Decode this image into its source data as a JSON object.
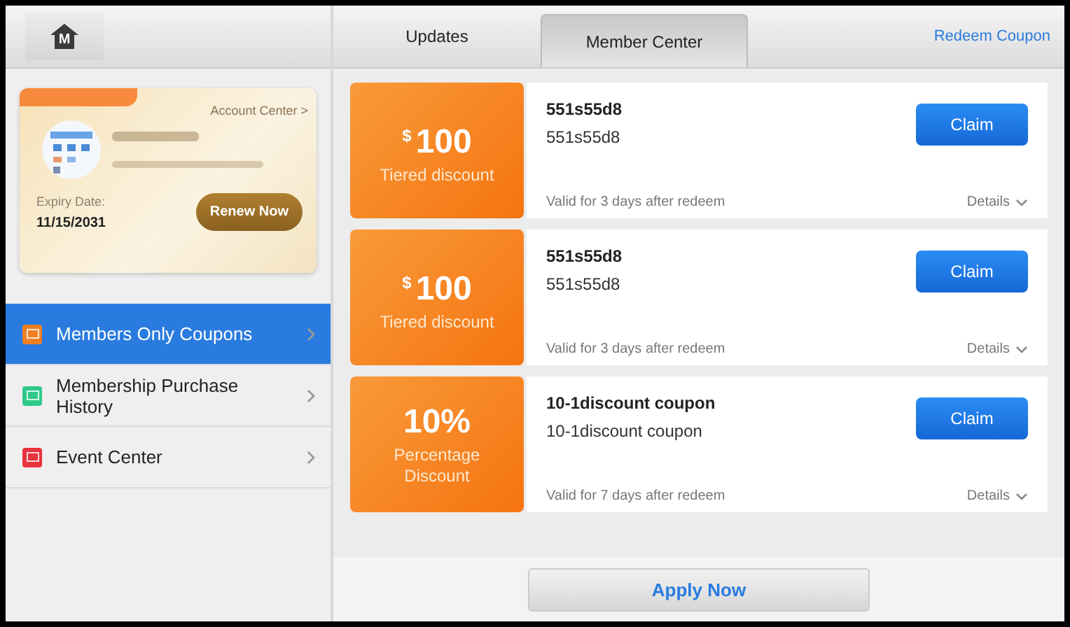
{
  "home_button": {
    "letter": "M"
  },
  "member_card": {
    "account_link": "Account Center >",
    "expiry_label": "Expiry Date:",
    "expiry_date": "11/15/2031",
    "renew_button": "Renew Now"
  },
  "sidebar": {
    "items": [
      {
        "label": "Members Only Coupons",
        "color": "#f07f22",
        "selected": true
      },
      {
        "label": "Membership Purchase History",
        "color": "#2fc98a",
        "selected": false
      },
      {
        "label": "Event Center",
        "color": "#e8323c",
        "selected": false
      }
    ]
  },
  "tabs": [
    {
      "label": "Updates",
      "selected": false
    },
    {
      "label": "Member Center",
      "selected": true
    }
  ],
  "redeem_link": "Redeem Coupon",
  "coupons": [
    {
      "currency": "$",
      "amount": "100",
      "type": "Tiered discount",
      "title": "551s55d8",
      "subtitle": "551s55d8",
      "validity": "Valid for 3 days after redeem",
      "details": "Details",
      "claim": "Claim"
    },
    {
      "currency": "$",
      "amount": "100",
      "type": "Tiered discount",
      "title": "551s55d8",
      "subtitle": "551s55d8",
      "validity": "Valid for 3 days after redeem",
      "details": "Details",
      "claim": "Claim"
    },
    {
      "amount": "10%",
      "type": "Percentage Discount",
      "title": "10-1discount coupon",
      "subtitle": "10-1discount coupon",
      "validity": "Valid for 7 days after redeem",
      "details": "Details",
      "claim": "Claim"
    }
  ],
  "apply_button": "Apply Now"
}
